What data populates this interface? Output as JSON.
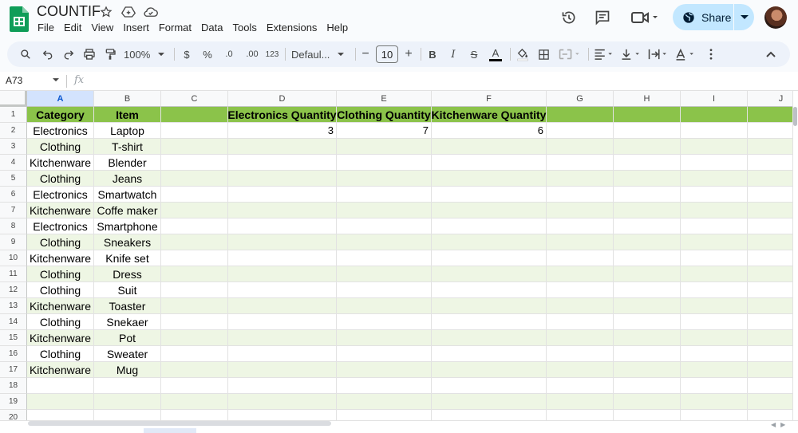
{
  "app": {
    "doc_title": "COUNTIF",
    "menu": [
      "File",
      "Edit",
      "View",
      "Insert",
      "Format",
      "Data",
      "Tools",
      "Extensions",
      "Help"
    ],
    "share_label": "Share"
  },
  "toolbar": {
    "zoom": "100%",
    "currency": "$",
    "percent": "%",
    "dec_decrease": ".0",
    "dec_increase": ".00",
    "number_format": "123",
    "font": "Defaul...",
    "font_size": "10",
    "minus": "−",
    "plus": "+",
    "bold": "B",
    "italic": "I",
    "strike": "S",
    "text_color": "A"
  },
  "formula_bar": {
    "name_box": "A73",
    "fx": "fx"
  },
  "columns": [
    "A",
    "B",
    "C",
    "D",
    "E",
    "F",
    "G",
    "H",
    "I",
    "J"
  ],
  "rows": [
    "1",
    "2",
    "3",
    "4",
    "5",
    "6",
    "7",
    "8",
    "9",
    "10",
    "11",
    "12",
    "13",
    "14",
    "15",
    "16",
    "17",
    "18",
    "19",
    "20"
  ],
  "header_row": [
    "Category",
    "Item",
    "",
    "Electronics Quantity",
    "Clothing Quantity",
    "Kitchenware Quantity",
    "",
    "",
    "",
    ""
  ],
  "counts": {
    "electronics": "3",
    "clothing": "7",
    "kitchenware": "6"
  },
  "data": [
    [
      "Electronics",
      "Laptop"
    ],
    [
      "Clothing",
      "T-shirt"
    ],
    [
      "Kitchenware",
      "Blender"
    ],
    [
      "Clothing",
      "Jeans"
    ],
    [
      "Electronics",
      "Smartwatch"
    ],
    [
      "Kitchenware",
      "Coffe maker"
    ],
    [
      "Electronics",
      "Smartphone"
    ],
    [
      "Clothing",
      "Sneakers"
    ],
    [
      "Kitchenware",
      "Knife set"
    ],
    [
      "Clothing",
      "Dress"
    ],
    [
      "Clothing",
      "Suit"
    ],
    [
      "Kitchenware",
      "Toaster"
    ],
    [
      "Clothing",
      "Snekaer"
    ],
    [
      "Kitchenware",
      "Pot"
    ],
    [
      "Clothing",
      "Sweater"
    ],
    [
      "Kitchenware",
      "Mug"
    ]
  ],
  "colors": {
    "header_fill": "#8bc34a",
    "band_fill": "#eef6e4",
    "selected_col": "#d3e3fd",
    "share_bg": "#c2e7ff",
    "sheets_green": "#0f9d58"
  }
}
